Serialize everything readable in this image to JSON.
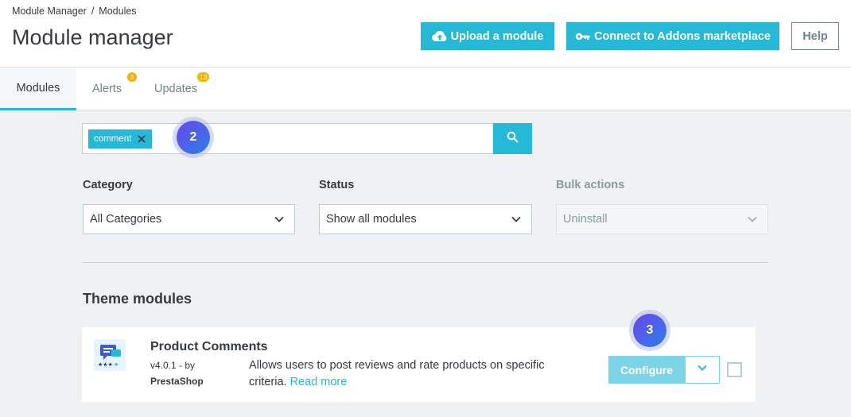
{
  "header": {
    "breadcrumb": [
      "Module Manager",
      "Modules"
    ],
    "breadcrumb_sep": "/",
    "title": "Module manager",
    "upload_label": "Upload a module",
    "connect_label": "Connect to Addons marketplace",
    "help_label": "Help"
  },
  "tabs": [
    {
      "label": "Modules",
      "active": true
    },
    {
      "label": "Alerts",
      "badge": "3"
    },
    {
      "label": "Updates",
      "badge": "13"
    }
  ],
  "search": {
    "tag": "comment",
    "value": ""
  },
  "steps": {
    "search": "2",
    "configure": "3"
  },
  "filters": {
    "category_label": "Category",
    "category_value": "All Categories",
    "status_label": "Status",
    "status_value": "Show all modules",
    "bulk_label": "Bulk actions",
    "bulk_value": "Uninstall"
  },
  "section": {
    "title": "Theme modules"
  },
  "module": {
    "name": "Product Comments",
    "version": "v4.0.1 - by",
    "author": "PrestaShop",
    "description": "Allows users to post reviews and rate products on specific criteria.",
    "read_more": "Read more",
    "configure_label": "Configure",
    "icon": "product-comments-icon"
  },
  "colors": {
    "primary": "#25b9d7",
    "badge": "#fab000",
    "step": "#5a5ce9"
  }
}
